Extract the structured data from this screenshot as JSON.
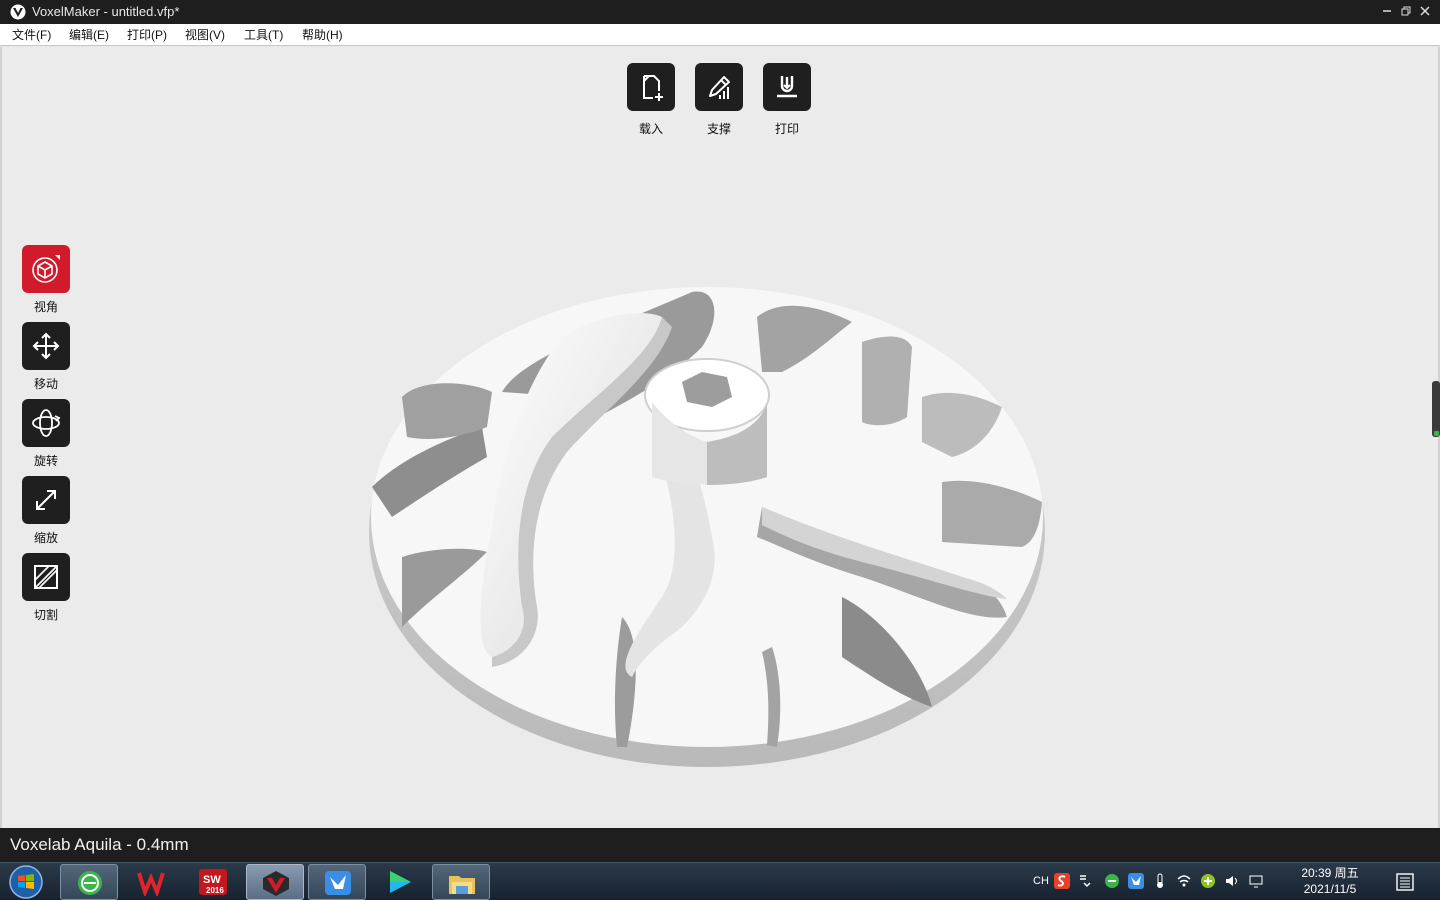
{
  "window": {
    "title": "VoxelMaker - untitled.vfp*"
  },
  "menu": [
    {
      "label": "文件(F)"
    },
    {
      "label": "编辑(E)"
    },
    {
      "label": "打印(P)"
    },
    {
      "label": "视图(V)"
    },
    {
      "label": "工具(T)"
    },
    {
      "label": "帮助(H)"
    }
  ],
  "top_toolbar": {
    "load": {
      "label": "载入",
      "icon": "file-add-icon"
    },
    "support": {
      "label": "支撑",
      "icon": "pen-support-icon"
    },
    "print": {
      "label": "打印",
      "icon": "print-download-icon"
    }
  },
  "left_toolbar": {
    "view": {
      "label": "视角",
      "icon": "cube-view-icon",
      "active": true
    },
    "move": {
      "label": "移动",
      "icon": "move-arrows-icon"
    },
    "rotate": {
      "label": "旋转",
      "icon": "rotate-icon"
    },
    "scale": {
      "label": "缩放",
      "icon": "scale-diagonal-icon"
    },
    "cut": {
      "label": "切割",
      "icon": "cut-slice-icon"
    }
  },
  "status": {
    "printer": "Voxelab Aquila - 0.4mm"
  },
  "taskbar": {
    "apps": [
      "browser-icon",
      "wps-icon",
      "solidworks-icon",
      "voxelmaker-icon",
      "feishu-icon",
      "video-player-icon",
      "file-explorer-icon"
    ],
    "sw_label": "SW",
    "sw_year": "2016",
    "ime": "CH",
    "clock_time": "20:39 周五",
    "clock_date": "2021/11/5"
  },
  "colors": {
    "accent": "#d11b2c",
    "toolbar_button": "#1f1f1f",
    "viewport": "#ebebeb"
  }
}
